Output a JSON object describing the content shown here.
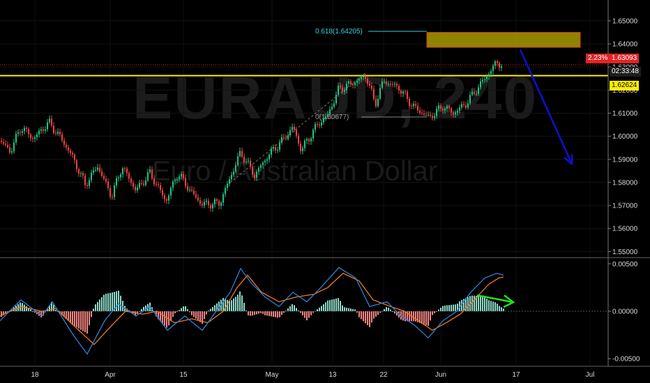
{
  "watermark": {
    "symbol": "EURAUD, 240",
    "description": "Euro / Australian Dollar"
  },
  "price_labels": {
    "change": "2.23%",
    "last": "1.63093",
    "countdown": "02:33:48",
    "level": "1.62624"
  },
  "annotations": {
    "fib_618": "0.618(1.64205)",
    "fib_swing": "0(1.60677)"
  },
  "colors": {
    "bull": "#26c281",
    "bear": "#e84444",
    "level": "#ffee00",
    "zone": "#a89a00",
    "arrow": "#1010d0",
    "arrow_osc": "#22dd22",
    "macd": "#2f7fd6",
    "signal": "#f07a1f",
    "hist_pos": "#8fdccb",
    "hist_neg": "#f48585"
  },
  "chart_data": [
    {
      "type": "candlestick",
      "title": "EURAUD, 240",
      "ylim": [
        1.548,
        1.656
      ],
      "y_ticks": [
        "1.65000",
        "1.64000",
        "1.63000",
        "1.62000",
        "1.61000",
        "1.60000",
        "1.59000",
        "1.58000",
        "1.57000",
        "1.56000",
        "1.55000"
      ],
      "x_ticks": [
        "18",
        "Apr",
        "15",
        "May",
        "13",
        "22",
        "Jun",
        "17",
        "Jul"
      ],
      "close_path": [
        {
          "x": 0,
          "y": 1.598
        },
        {
          "x": 15,
          "y": 1.5935
        },
        {
          "x": 30,
          "y": 1.604
        },
        {
          "x": 48,
          "y": 1.599
        },
        {
          "x": 70,
          "y": 1.606
        },
        {
          "x": 90,
          "y": 1.598
        },
        {
          "x": 105,
          "y": 1.5905
        },
        {
          "x": 122,
          "y": 1.579
        },
        {
          "x": 140,
          "y": 1.587
        },
        {
          "x": 160,
          "y": 1.574
        },
        {
          "x": 175,
          "y": 1.587
        },
        {
          "x": 195,
          "y": 1.5765
        },
        {
          "x": 215,
          "y": 1.584
        },
        {
          "x": 238,
          "y": 1.572
        },
        {
          "x": 255,
          "y": 1.584
        },
        {
          "x": 275,
          "y": 1.5755
        },
        {
          "x": 290,
          "y": 1.5705
        },
        {
          "x": 315,
          "y": 1.571
        },
        {
          "x": 345,
          "y": 1.593
        },
        {
          "x": 365,
          "y": 1.583
        },
        {
          "x": 385,
          "y": 1.592
        },
        {
          "x": 405,
          "y": 1.598
        },
        {
          "x": 420,
          "y": 1.604
        },
        {
          "x": 432,
          "y": 1.594
        },
        {
          "x": 455,
          "y": 1.605
        },
        {
          "x": 470,
          "y": 1.609
        },
        {
          "x": 485,
          "y": 1.62
        },
        {
          "x": 505,
          "y": 1.623
        },
        {
          "x": 525,
          "y": 1.626
        },
        {
          "x": 538,
          "y": 1.614
        },
        {
          "x": 550,
          "y": 1.624
        },
        {
          "x": 572,
          "y": 1.621
        },
        {
          "x": 592,
          "y": 1.613
        },
        {
          "x": 615,
          "y": 1.608
        },
        {
          "x": 635,
          "y": 1.613
        },
        {
          "x": 650,
          "y": 1.61
        },
        {
          "x": 668,
          "y": 1.614
        },
        {
          "x": 685,
          "y": 1.621
        },
        {
          "x": 700,
          "y": 1.627
        },
        {
          "x": 712,
          "y": 1.632
        },
        {
          "x": 720,
          "y": 1.6309
        }
      ],
      "levels": [
        1.62624
      ],
      "zone": {
        "x": [
          612,
          832
        ],
        "y": [
          1.6385,
          1.645
        ]
      },
      "projection_arrow": {
        "from": [
          746,
          1.6375
        ],
        "to": [
          820,
          1.588
        ]
      }
    },
    {
      "type": "macd",
      "ylim": [
        -0.0055,
        0.0055
      ],
      "y_ticks": [
        "0.00500",
        "0.00000",
        "-0.00500"
      ],
      "macd_path": [
        {
          "x": 0,
          "y": -0.001
        },
        {
          "x": 30,
          "y": 0.0012
        },
        {
          "x": 60,
          "y": -0.0005
        },
        {
          "x": 75,
          "y": 0.001
        },
        {
          "x": 105,
          "y": -0.0025
        },
        {
          "x": 125,
          "y": -0.0045
        },
        {
          "x": 150,
          "y": -0.001
        },
        {
          "x": 170,
          "y": 0.0008
        },
        {
          "x": 195,
          "y": -0.0005
        },
        {
          "x": 215,
          "y": 0.0005
        },
        {
          "x": 240,
          "y": -0.002
        },
        {
          "x": 265,
          "y": -0.0005
        },
        {
          "x": 290,
          "y": -0.002
        },
        {
          "x": 315,
          "y": 0.0005
        },
        {
          "x": 330,
          "y": 0.002
        },
        {
          "x": 345,
          "y": 0.0045
        },
        {
          "x": 360,
          "y": 0.003
        },
        {
          "x": 380,
          "y": 0.0015
        },
        {
          "x": 400,
          "y": 0.0005
        },
        {
          "x": 420,
          "y": 0.002
        },
        {
          "x": 440,
          "y": 0.001
        },
        {
          "x": 460,
          "y": 0.0025
        },
        {
          "x": 486,
          "y": 0.0046
        },
        {
          "x": 510,
          "y": 0.0035
        },
        {
          "x": 530,
          "y": 0.0005
        },
        {
          "x": 555,
          "y": 0.001
        },
        {
          "x": 575,
          "y": -0.0005
        },
        {
          "x": 595,
          "y": -0.0015
        },
        {
          "x": 614,
          "y": -0.0028
        },
        {
          "x": 635,
          "y": -0.001
        },
        {
          "x": 655,
          "y": 0.0
        },
        {
          "x": 675,
          "y": 0.002
        },
        {
          "x": 695,
          "y": 0.0035
        },
        {
          "x": 712,
          "y": 0.004
        },
        {
          "x": 722,
          "y": 0.0038
        }
      ],
      "signal_path": [
        {
          "x": 0,
          "y": -0.0005
        },
        {
          "x": 30,
          "y": 0.0005
        },
        {
          "x": 60,
          "y": 0.0
        },
        {
          "x": 80,
          "y": 0.0003
        },
        {
          "x": 110,
          "y": -0.0018
        },
        {
          "x": 135,
          "y": -0.0035
        },
        {
          "x": 160,
          "y": -0.0015
        },
        {
          "x": 180,
          "y": 0.0
        },
        {
          "x": 205,
          "y": -0.0003
        },
        {
          "x": 225,
          "y": 0.0
        },
        {
          "x": 250,
          "y": -0.0012
        },
        {
          "x": 275,
          "y": -0.0008
        },
        {
          "x": 298,
          "y": -0.0012
        },
        {
          "x": 320,
          "y": 0.0
        },
        {
          "x": 340,
          "y": 0.0025
        },
        {
          "x": 355,
          "y": 0.0038
        },
        {
          "x": 375,
          "y": 0.002
        },
        {
          "x": 400,
          "y": 0.001
        },
        {
          "x": 425,
          "y": 0.0015
        },
        {
          "x": 450,
          "y": 0.0018
        },
        {
          "x": 470,
          "y": 0.0025
        },
        {
          "x": 492,
          "y": 0.004
        },
        {
          "x": 515,
          "y": 0.0032
        },
        {
          "x": 535,
          "y": 0.0012
        },
        {
          "x": 560,
          "y": 0.0005
        },
        {
          "x": 580,
          "y": 0.0
        },
        {
          "x": 600,
          "y": -0.001
        },
        {
          "x": 620,
          "y": -0.002
        },
        {
          "x": 640,
          "y": -0.0012
        },
        {
          "x": 660,
          "y": -0.0003
        },
        {
          "x": 680,
          "y": 0.0012
        },
        {
          "x": 700,
          "y": 0.0028
        },
        {
          "x": 715,
          "y": 0.0035
        },
        {
          "x": 722,
          "y": 0.0036
        }
      ]
    }
  ]
}
